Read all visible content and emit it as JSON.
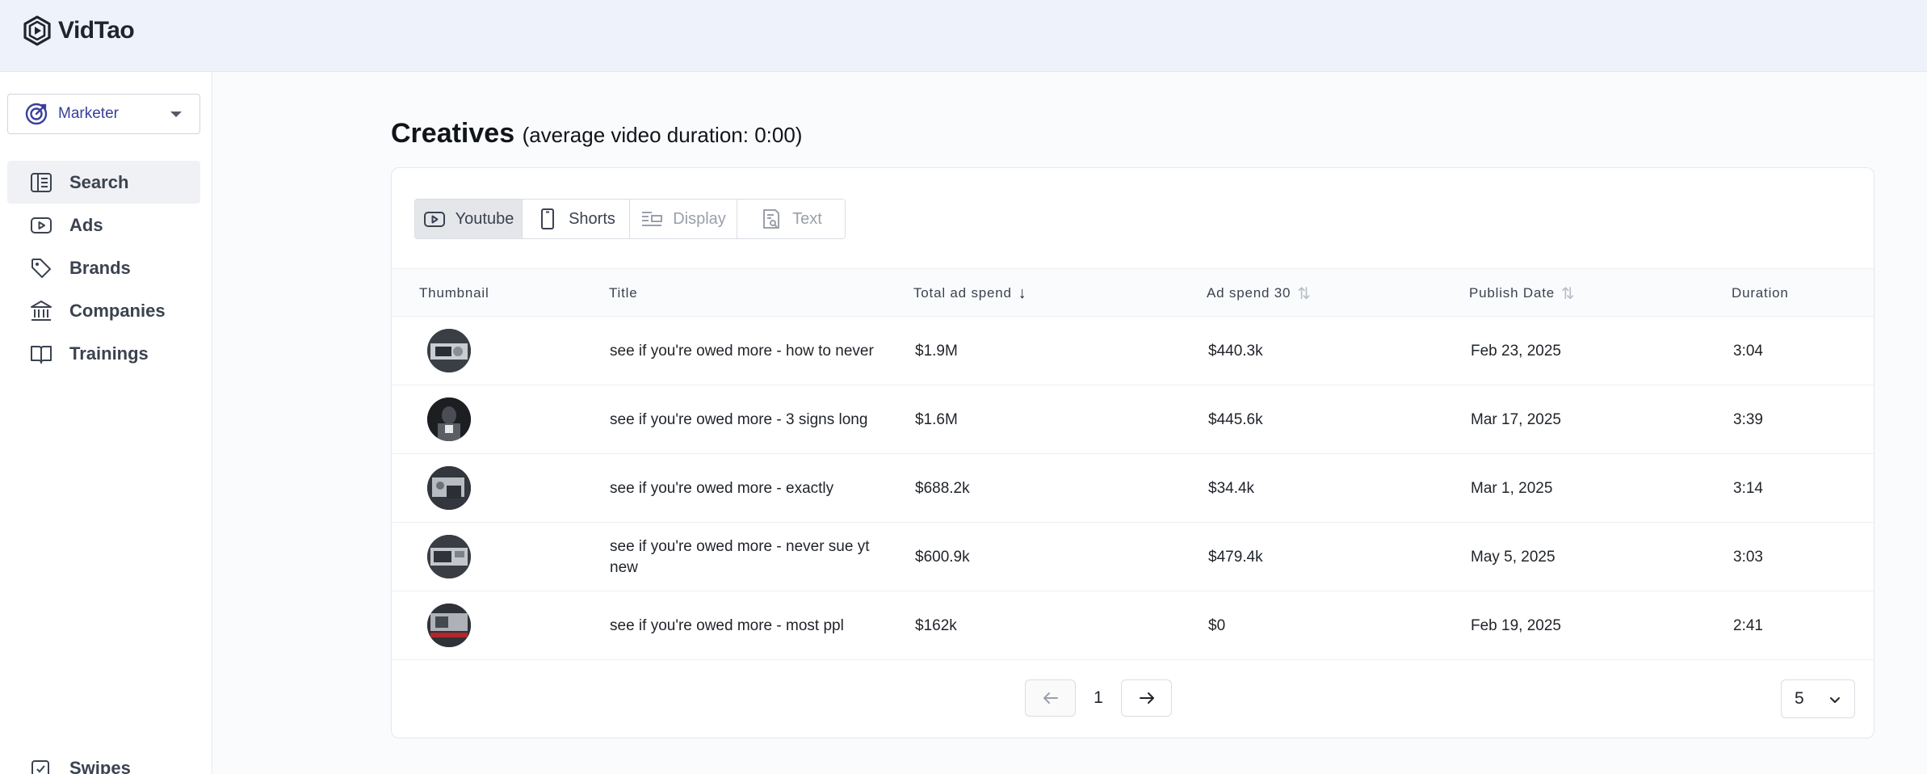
{
  "app": {
    "name": "VidTao"
  },
  "sidebar": {
    "role": "Marketer",
    "items": [
      {
        "label": "Search",
        "icon": "search-panel-icon",
        "active": true
      },
      {
        "label": "Ads",
        "icon": "play-icon"
      },
      {
        "label": "Brands",
        "icon": "tag-icon"
      },
      {
        "label": "Companies",
        "icon": "bank-icon"
      },
      {
        "label": "Trainings",
        "icon": "book-icon"
      }
    ],
    "bottom_item": {
      "label": "Swipes",
      "icon": "swipes-icon"
    }
  },
  "page": {
    "title": "Creatives",
    "subtitle": "(average video duration: 0:00)"
  },
  "tabs": [
    {
      "label": "Youtube",
      "icon": "youtube-play-icon",
      "state": "active"
    },
    {
      "label": "Shorts",
      "icon": "phone-icon",
      "state": "enabled"
    },
    {
      "label": "Display",
      "icon": "display-layout-icon",
      "state": "disabled"
    },
    {
      "label": "Text",
      "icon": "text-doc-icon",
      "state": "disabled"
    }
  ],
  "table": {
    "columns": [
      "Thumbnail",
      "Title",
      "Total ad spend",
      "Ad spend 30",
      "Publish Date",
      "Duration"
    ],
    "sort": {
      "column": "Total ad spend",
      "direction": "desc"
    },
    "rows": [
      {
        "title": "see if you're owed more - how to never",
        "total_ad_spend": "$1.9M",
        "ad_spend_30": "$440.3k",
        "publish_date": "Feb 23, 2025",
        "duration": "3:04"
      },
      {
        "title": "see if you're owed more - 3 signs long",
        "total_ad_spend": "$1.6M",
        "ad_spend_30": "$445.6k",
        "publish_date": "Mar 17, 2025",
        "duration": "3:39"
      },
      {
        "title": "see if you're owed more - exactly",
        "total_ad_spend": "$688.2k",
        "ad_spend_30": "$34.4k",
        "publish_date": "Mar 1, 2025",
        "duration": "3:14"
      },
      {
        "title": "see if you're owed more - never sue yt new",
        "total_ad_spend": "$600.9k",
        "ad_spend_30": "$479.4k",
        "publish_date": "May 5, 2025",
        "duration": "3:03"
      },
      {
        "title": "see if you're owed more - most ppl",
        "total_ad_spend": "$162k",
        "ad_spend_30": "$0",
        "publish_date": "Feb 19, 2025",
        "duration": "2:41"
      }
    ]
  },
  "pagination": {
    "current_page": "1",
    "page_size": "5"
  },
  "colors": {
    "accent": "#3a3f9a",
    "topbar": "#eef2fb",
    "active_tab": "#e4e6ea"
  }
}
